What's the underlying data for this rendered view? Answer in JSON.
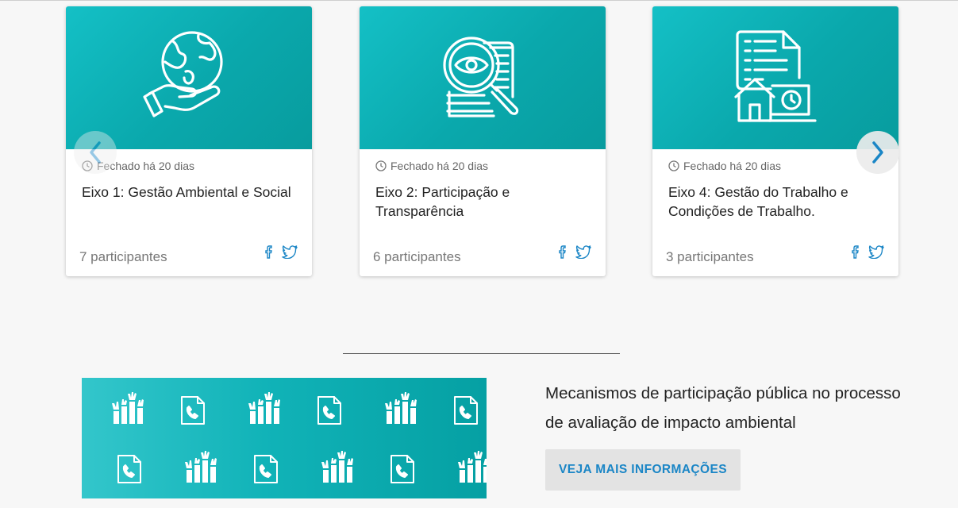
{
  "cards": [
    {
      "hero_icon": "globe-hand-icon",
      "status": "Fechado há 20 dias",
      "title": "Eixo 1: Gestão Ambiental e Social",
      "participants": "7 participantes"
    },
    {
      "hero_icon": "magnifier-eye-document-icon",
      "status": "Fechado há 20 dias",
      "title": "Eixo 2: Participação e Transparência",
      "participants": "6 participantes"
    },
    {
      "hero_icon": "document-house-clock-icon",
      "status": "Fechado há 20 dias",
      "title": "Eixo 4: Gestão do Trabalho e Condições de Trabalho.",
      "participants": "3 participantes"
    }
  ],
  "share_icons": [
    "facebook-icon",
    "twitter-icon"
  ],
  "carousel": {
    "prev_icon": "chevron-left-icon",
    "next_icon": "chevron-right-icon"
  },
  "info": {
    "title": "Mecanismos de participação pública no processo de avaliação de impacto ambiental",
    "button_label": "VEJA MAIS INFORMAÇÕES"
  },
  "banner": {
    "pattern_icons": [
      "raised-hands-icon",
      "phone-document-icon"
    ]
  },
  "colors": {
    "teal": "#0aa8ac",
    "link_blue": "#1b86c6",
    "background": "#f7f7f7"
  }
}
